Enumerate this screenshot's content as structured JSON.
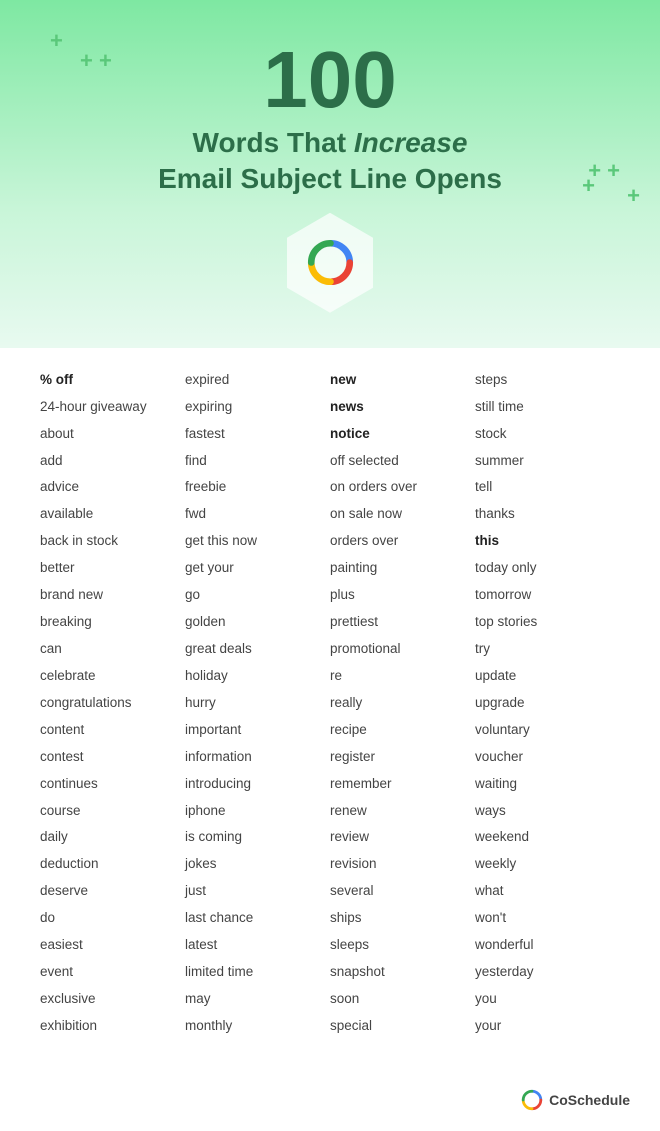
{
  "header": {
    "number": "100",
    "subtitle_line1": "Words That ",
    "subtitle_italic": "Increase",
    "subtitle_line2": "Email Subject Line Opens"
  },
  "columns": [
    {
      "words": [
        "% off",
        "24-hour giveaway",
        "about",
        "add",
        "advice",
        "available",
        "back in stock",
        "better",
        "brand new",
        "breaking",
        "can",
        "celebrate",
        "congratulations",
        "content",
        "contest",
        "continues",
        "course",
        "daily",
        "deduction",
        "deserve",
        "do",
        "easiest",
        "event",
        "exclusive",
        "exhibition"
      ]
    },
    {
      "words": [
        "expired",
        "expiring",
        "fastest",
        "find",
        "freebie",
        "fwd",
        "get this now",
        "get your",
        "go",
        "golden",
        "great deals",
        "holiday",
        "hurry",
        "important",
        "information",
        "introducing",
        "iphone",
        "is coming",
        "jokes",
        "just",
        "last chance",
        "latest",
        "limited time",
        "may",
        "monthly"
      ]
    },
    {
      "words": [
        "new",
        "news",
        "notice",
        "off selected",
        "on orders over",
        "on sale now",
        "orders over",
        "painting",
        "plus",
        "prettiest",
        "promotional",
        "re",
        "really",
        "recipe",
        "register",
        "remember",
        "renew",
        "review",
        "revision",
        "several",
        "ships",
        "sleeps",
        "snapshot",
        "soon",
        "special"
      ]
    },
    {
      "words": [
        "steps",
        "still time",
        "stock",
        "summer",
        "tell",
        "thanks",
        "this",
        "today only",
        "tomorrow",
        "top stories",
        "try",
        "update",
        "upgrade",
        "voluntary",
        "voucher",
        "waiting",
        "ways",
        "weekend",
        "weekly",
        "what",
        "won't",
        "wonderful",
        "yesterday",
        "you",
        "your"
      ]
    }
  ],
  "footer": {
    "brand": "CoSchedule"
  }
}
